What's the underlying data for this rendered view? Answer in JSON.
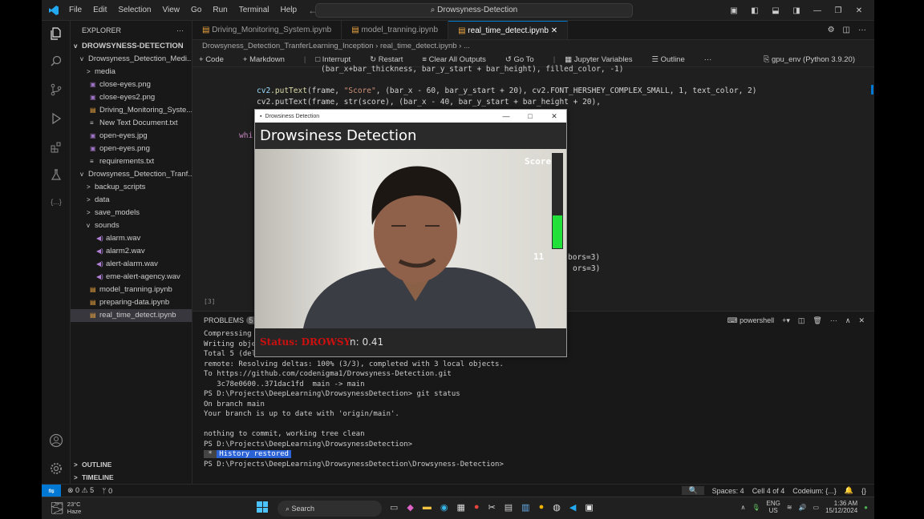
{
  "titlebar": {
    "menus": [
      "File",
      "Edit",
      "Selection",
      "View",
      "Go",
      "Run",
      "Terminal",
      "Help"
    ],
    "search": "Drowsyness-Detection"
  },
  "explorer": {
    "title": "EXPLORER",
    "root": "DROWSYNESS-DETECTION",
    "rows": [
      {
        "label": "Drowsyness_Detection_Medi...",
        "depth": 1,
        "chev": "v",
        "icon": ""
      },
      {
        "label": "media",
        "depth": 2,
        "chev": ">",
        "icon": ""
      },
      {
        "label": "close-eyes.png",
        "depth": 2,
        "chev": "",
        "icon": "img"
      },
      {
        "label": "close-eyes2.png",
        "depth": 2,
        "chev": "",
        "icon": "img"
      },
      {
        "label": "Driving_Monitoring_Syste...",
        "depth": 2,
        "chev": "",
        "icon": "nb"
      },
      {
        "label": "New Text Document.txt",
        "depth": 2,
        "chev": "",
        "icon": "txt"
      },
      {
        "label": "open-eyes.jpg",
        "depth": 2,
        "chev": "",
        "icon": "img"
      },
      {
        "label": "open-eyes.png",
        "depth": 2,
        "chev": "",
        "icon": "img"
      },
      {
        "label": "requirements.txt",
        "depth": 2,
        "chev": "",
        "icon": "txt"
      },
      {
        "label": "Drowsyness_Detection_Tranf...",
        "depth": 1,
        "chev": "v",
        "icon": ""
      },
      {
        "label": "backup_scripts",
        "depth": 2,
        "chev": ">",
        "icon": ""
      },
      {
        "label": "data",
        "depth": 2,
        "chev": ">",
        "icon": ""
      },
      {
        "label": "save_models",
        "depth": 2,
        "chev": ">",
        "icon": ""
      },
      {
        "label": "sounds",
        "depth": 2,
        "chev": "v",
        "icon": ""
      },
      {
        "label": "alarm.wav",
        "depth": 3,
        "chev": "",
        "icon": "snd"
      },
      {
        "label": "alarm2.wav",
        "depth": 3,
        "chev": "",
        "icon": "snd"
      },
      {
        "label": "alert-alarm.wav",
        "depth": 3,
        "chev": "",
        "icon": "snd"
      },
      {
        "label": "eme-alert-agency.wav",
        "depth": 3,
        "chev": "",
        "icon": "snd"
      },
      {
        "label": "model_tranning.ipynb",
        "depth": 2,
        "chev": "",
        "icon": "nb"
      },
      {
        "label": "preparing-data.ipynb",
        "depth": 2,
        "chev": "",
        "icon": "nb"
      },
      {
        "label": "real_time_detect.ipynb",
        "depth": 2,
        "chev": "",
        "icon": "nb",
        "selected": true
      }
    ],
    "outline": "OUTLINE",
    "timeline": "TIMELINE"
  },
  "tabs": [
    {
      "label": "Driving_Monitoring_System.ipynb"
    },
    {
      "label": "model_tranning.ipynb"
    },
    {
      "label": "real_time_detect.ipynb",
      "active": true
    }
  ],
  "breadcrumb": "Drowsyness_Detection_TranferLearning_Inception  ›  real_time_detect.ipynb  ›  ...",
  "toolbar": {
    "code": "Code",
    "markdown": "Markdown",
    "interrupt": "Interrupt",
    "restart": "Restart",
    "clear": "Clear All Outputs",
    "goto": "Go To",
    "variables": "Jupyter Variables",
    "outline": "Outline",
    "kernel": "gpu_env (Python 3.9.20)"
  },
  "code": {
    "l0": "(bar_x+bar_thickness, bar_y_start + bar_height), filled_color, -1)",
    "l1a": "cv2",
    "l1b": ".putText",
    "l1c": "(frame, ",
    "l1d": "\"Score\"",
    "l1e": ", (bar_x - 60, bar_y_start + 20), cv2.FONT_HERSHEY_COMPLEX_SMALL, 1, text_color, 2)",
    "l2": "cv2.putText(frame, str(score), (bar_x - 40, bar_y_start + bar_height + 20),",
    "l3": "whi",
    "l4": "bors=3)",
    "l5": "ors=3)",
    "cell_label": "[3]"
  },
  "panel": {
    "problems": "PROBLEMS",
    "problem_count": "5",
    "shell": "powershell",
    "lines": [
      "Compressing",
      "Writing obje",
      "Total 5 (delta 3), reused 0 (delta 0), pack-reused 0 (from 0)",
      "remote: Resolving deltas: 100% (3/3), completed with 3 local objects.",
      "To https://github.com/codenigma1/Drowsyness-Detection.git",
      "   3c78e0600..371dac1fd  main -> main",
      "PS D:\\Projects\\DeepLearning\\DrowsynessDetection> git status",
      "On branch main",
      "Your branch is up to date with 'origin/main'.",
      "",
      "nothing to commit, working tree clean",
      "PS D:\\Projects\\DeepLearning\\DrowsynessDetection>",
      "",
      "PS D:\\Projects\\DeepLearning\\DrowsynessDetection\\Drowsyness-Detection>"
    ],
    "history": "History restored"
  },
  "status": {
    "errors": "0",
    "warnings": "5",
    "ports": "0",
    "spaces": "Spaces: 4",
    "cell": "Cell 4 of 4",
    "codeium": "Codeium: {...}"
  },
  "cvwindow": {
    "title": "Drowsiness Detection",
    "header": "Drowsiness Detection",
    "score_label": "Score",
    "score_value": "11",
    "status_overlay": "Status: DROWSY",
    "confidence": "n: 0.41",
    "score_fill": 0.35
  },
  "taskbar": {
    "temp": "23°C",
    "weather": "Haze",
    "search": "Search",
    "lang1": "ENG",
    "lang2": "US",
    "time": "1:36 AM",
    "date": "15/12/2024"
  },
  "colors": {
    "accent": "#0078d4",
    "score_bar": "#22e03a",
    "status_red": "#cc1010"
  }
}
